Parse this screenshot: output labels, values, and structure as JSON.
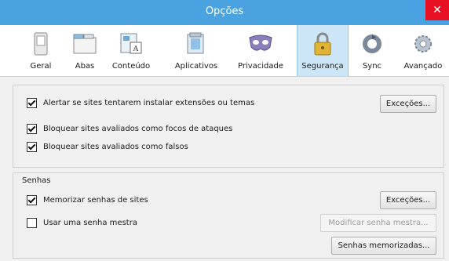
{
  "window": {
    "title": "Opções",
    "close_icon": "close-icon"
  },
  "toolbar": {
    "items": [
      {
        "label": "Geral",
        "icon": "switch-icon"
      },
      {
        "label": "Abas",
        "icon": "tabs-icon"
      },
      {
        "label": "Conteúdo",
        "icon": "content-icon"
      },
      {
        "label": "Aplicativos",
        "icon": "applications-icon"
      },
      {
        "label": "Privacidade",
        "icon": "mask-icon"
      },
      {
        "label": "Segurança",
        "icon": "padlock-icon",
        "selected": true
      },
      {
        "label": "Sync",
        "icon": "sync-icon"
      },
      {
        "label": "Avançado",
        "icon": "gear-icon"
      }
    ]
  },
  "general_group": {
    "warn_addons": {
      "label": "Alertar se sites tentarem instalar extensões ou temas",
      "checked": true
    },
    "exceptions_button": "Exceções...",
    "block_attack": {
      "label": "Bloquear sites avaliados como focos de ataques",
      "checked": true
    },
    "block_forgery": {
      "label": "Bloquear sites avaliados como falsos",
      "checked": true
    }
  },
  "passwords": {
    "title": "Senhas",
    "remember": {
      "label": "Memorizar senhas de sites",
      "checked": true
    },
    "exceptions_button": "Exceções...",
    "master_password": {
      "label": "Usar uma senha mestra",
      "checked": false
    },
    "change_master_button": "Modificar senha mestra...",
    "saved_passwords_button": "Senhas memorizadas..."
  },
  "colors": {
    "titlebar": "#4aa3e0",
    "selected_tab": "#cde6f7",
    "close": "#e81123"
  }
}
